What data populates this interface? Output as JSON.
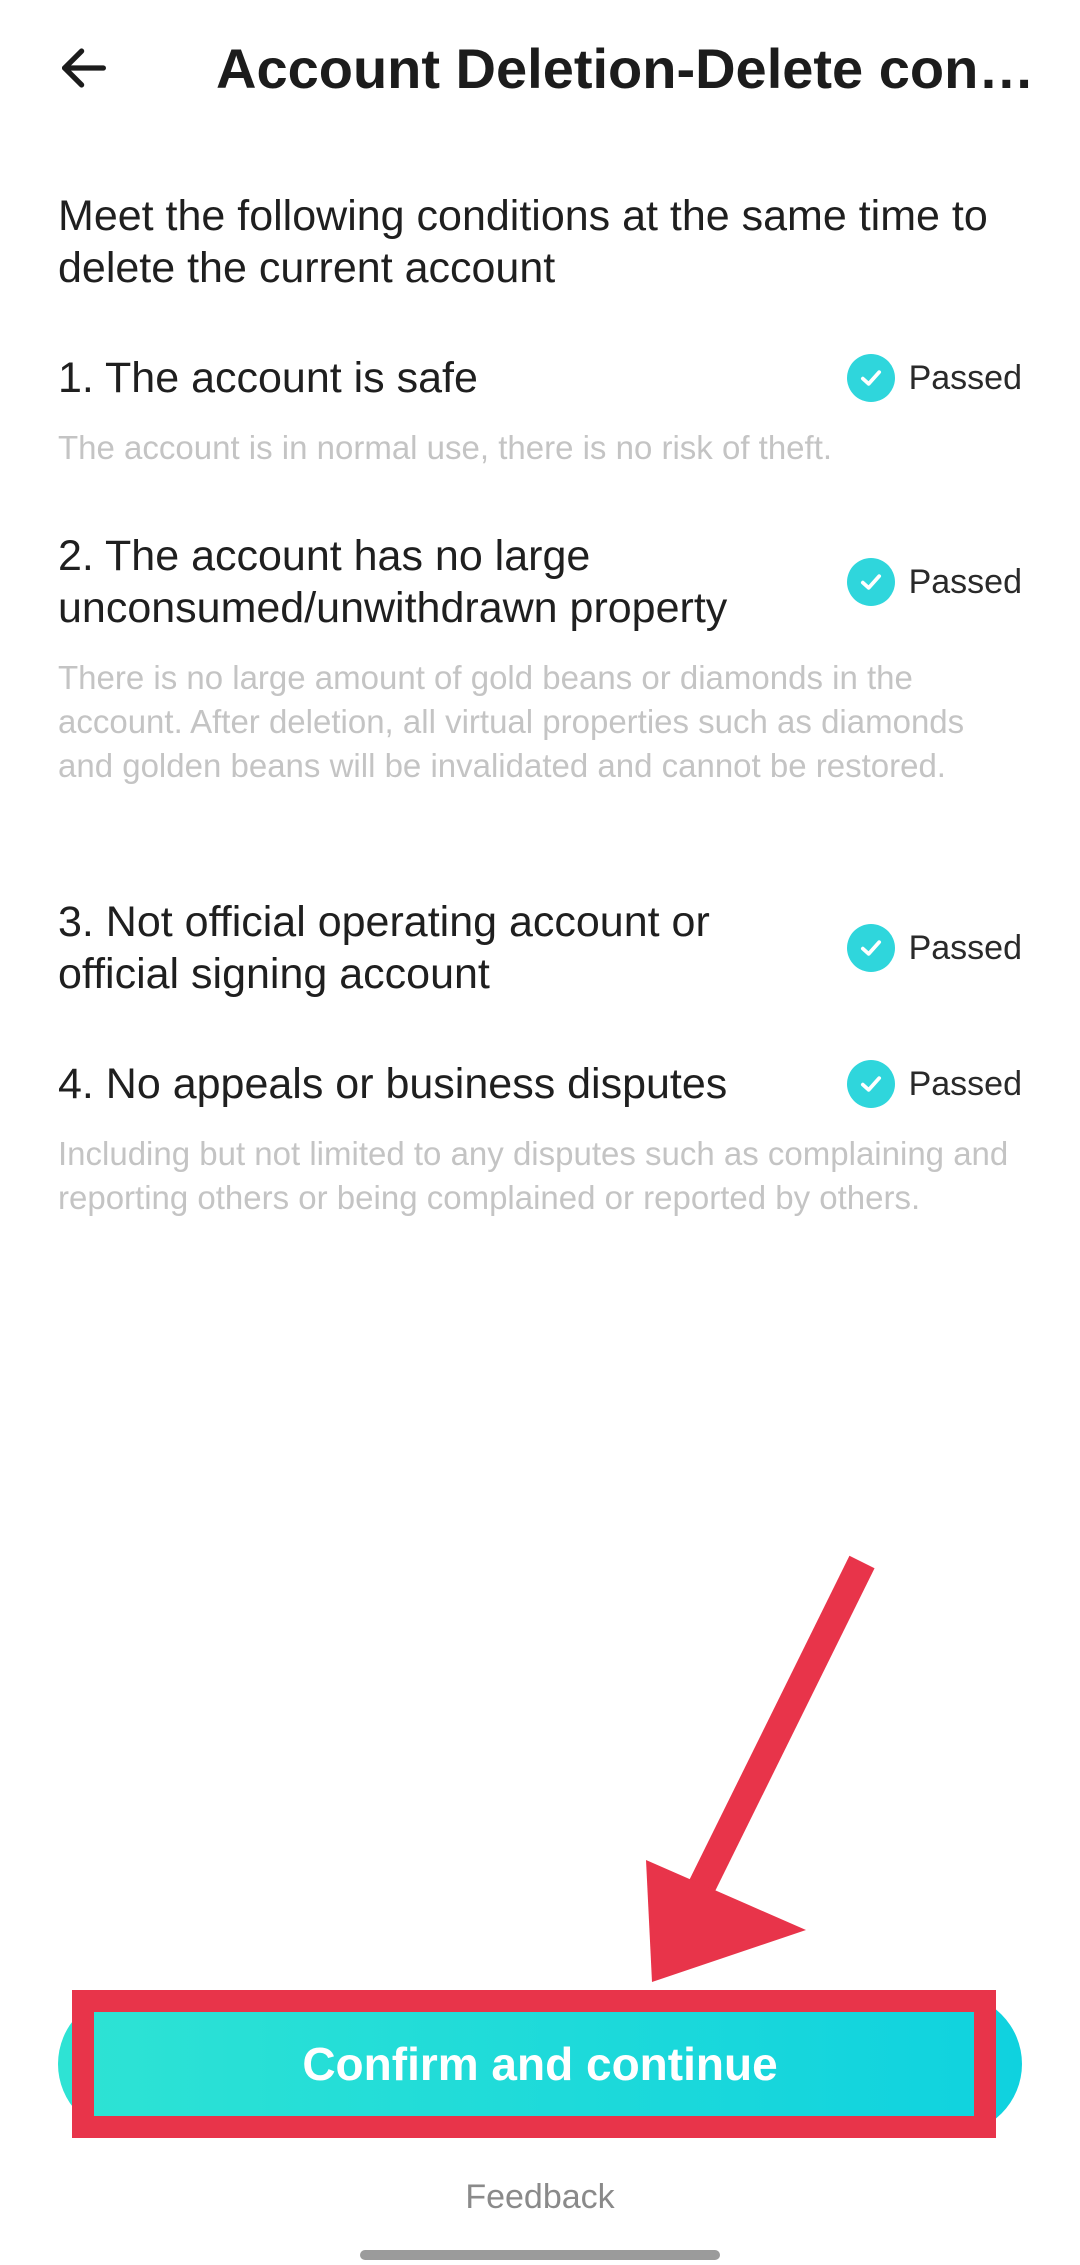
{
  "header": {
    "title": "Account Deletion-Delete cond…",
    "back_icon": "arrow-left-icon"
  },
  "intro": "Meet the following conditions at the same time to delete the current account",
  "conditions": [
    {
      "title": "1. The account is safe",
      "status": "Passed",
      "description": "The account is in normal use, there is no risk of theft."
    },
    {
      "title": "2. The account has no large unconsumed/unwithdrawn property",
      "status": "Passed",
      "description": "There is no large amount of gold beans or diamonds in the account. After deletion, all virtual properties such as diamonds and golden beans will be invalidated and cannot be restored."
    },
    {
      "title": "3. Not official operating account or official signing account",
      "status": "Passed",
      "description": ""
    },
    {
      "title": "4. No appeals or business disputes",
      "status": "Passed",
      "description": "Including but not limited to any disputes such as complaining and reporting others or being complained or reported by others."
    }
  ],
  "footer": {
    "confirm_label": "Confirm and continue",
    "feedback_label": "Feedback"
  },
  "colors": {
    "accent": "#1fd8dc",
    "annotation": "#e8344a",
    "muted_text": "#c4c4c4"
  }
}
